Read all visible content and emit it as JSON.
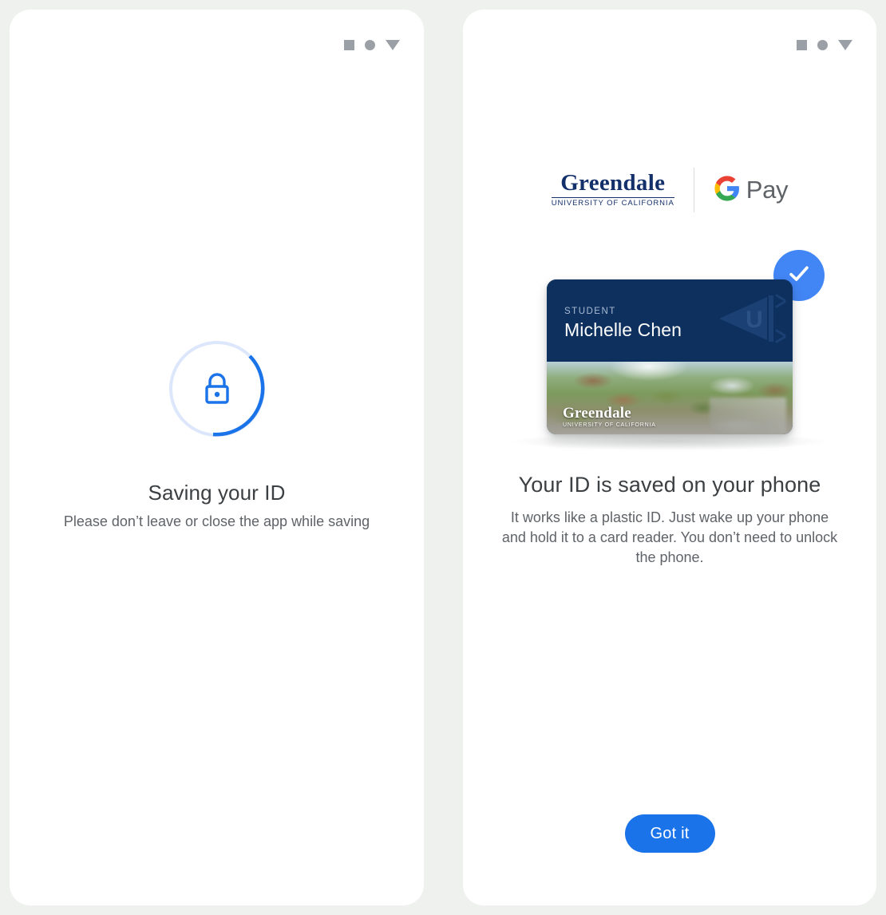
{
  "theme": {
    "page_background": "#eff1ef",
    "panel_background": "#ffffff",
    "accent_blue": "#1a73e8",
    "badge_blue": "#4285f4",
    "progress_track": "#dce7fb",
    "card_navy": "#0e305f",
    "brand_navy": "#14306b",
    "title_text": "#3c4043",
    "body_text": "#5f6368",
    "status_glyph": "#9aa0a6"
  },
  "left_screen": {
    "statusbar": {
      "icons": [
        "square-glyph",
        "circle-glyph",
        "triangle-glyph"
      ]
    },
    "progress": {
      "icon": "lock-icon",
      "percent": 40
    },
    "title": "Saving your ID",
    "subtitle": "Please don’t leave or close the app while saving"
  },
  "right_screen": {
    "statusbar": {
      "icons": [
        "square-glyph",
        "circle-glyph",
        "triangle-glyph"
      ]
    },
    "cobrand": {
      "university_word": "Greendale",
      "university_sub": "UNIVERSITY OF CALIFORNIA",
      "wallet_icon": "google-g-icon",
      "wallet_label": "Pay"
    },
    "card": {
      "badge_icon": "check-icon",
      "role": "STUDENT",
      "holder_name": "Michelle Chen",
      "emblem_icon": "university-pennant-emblem",
      "emblem_letter": "U",
      "logo_word": "Greendale",
      "logo_sub": "UNIVERSITY OF CALIFORNIA",
      "photo_alt": "aerial-campus-photo"
    },
    "title": "Your ID is saved on your phone",
    "body": "It works like a plastic ID. Just wake up your phone and hold it to a card reader. You don’t need to unlock the phone.",
    "cta_label": "Got it"
  }
}
